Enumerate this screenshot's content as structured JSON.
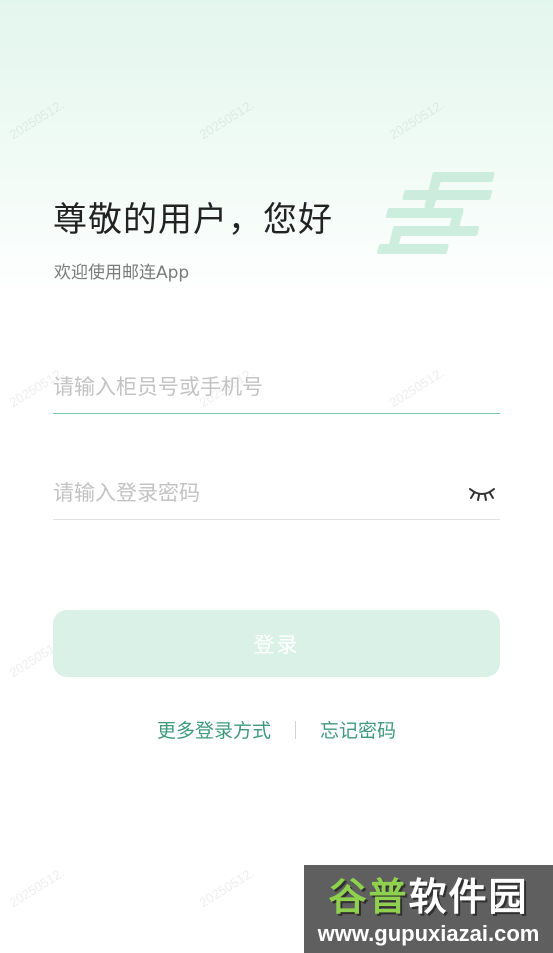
{
  "header": {
    "greeting": "尊敬的用户，您好",
    "subtitle": "欢迎使用邮连App"
  },
  "form": {
    "account_placeholder": "请输入柜员号或手机号",
    "account_value": "",
    "password_placeholder": "请输入登录密码",
    "password_value": "",
    "password_toggle_icon": "eye-closed-icon"
  },
  "actions": {
    "login_label": "登录",
    "more_login_label": "更多登录方式",
    "forgot_password_label": "忘记密码"
  },
  "watermark": {
    "text": "20250512."
  },
  "brand_badge": {
    "name_part1": "谷普",
    "name_part2": "软件园",
    "url": "www.gupuxiazai.com"
  },
  "colors": {
    "accent": "#3e9a7b",
    "button_disabled": "#d9f1e7",
    "active_underline": "#7ac4ad",
    "header_bg": "#e3f6ee"
  }
}
